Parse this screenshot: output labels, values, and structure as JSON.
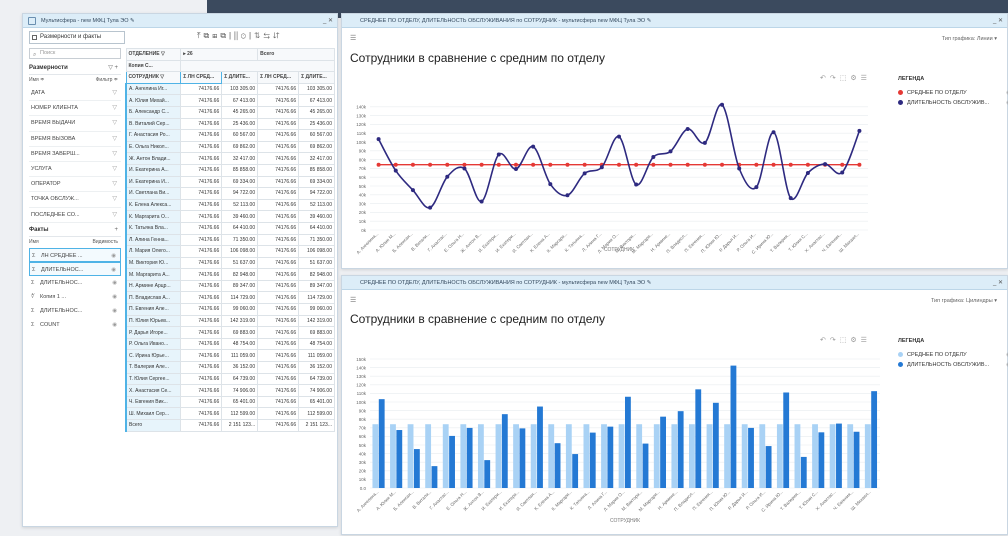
{
  "colors": {
    "accent": "#4fb3e6",
    "line_series": "#2e2a80",
    "avg_series": "#e53935",
    "bar_dark": "#2479d4",
    "bar_light": "#a9d2f5"
  },
  "left_panel": {
    "title": "Мультисфера - new МФЦ Тула ЭО ✎",
    "dropdown": "Размерности и факты",
    "search_placeholder": "Поиск",
    "dims_header": "Размерности",
    "dims_sub_left": "Имя ≑",
    "dims_sub_right": "Фильтр ≑",
    "dims": [
      "ДАТА",
      "НОМЕР КЛИЕНТА",
      "ВРЕМЯ ВЫДАЧИ",
      "ВРЕМЯ ВЫЗОВА",
      "ВРЕМЯ ЗАВЕРШ...",
      "УСЛУГА",
      "ОПЕРАТОР",
      "ТОЧКА ОБСЛУЖ...",
      "ПОСЛЕДНЕЕ СО..."
    ],
    "facts_header": "Факты",
    "facts_sub_left": "Имя",
    "facts_sub_right": "Видимость",
    "facts": [
      {
        "prefix": "Σ",
        "label": "ЛН СРЕДНЕЕ ...",
        "sel": true
      },
      {
        "prefix": "Σ",
        "label": "ДЛИТЕЛЬНОС...",
        "sel": true
      },
      {
        "prefix": "Σ",
        "label": "ДЛИТЕЛЬНОС...",
        "sel": false
      },
      {
        "prefix": "∜",
        "label": "Копия 1 ...",
        "sel": false
      },
      {
        "prefix": "Σ",
        "label": "ДЛИТЕЛЬНОС...",
        "sel": false
      },
      {
        "prefix": "Σ",
        "label": "COUNT",
        "sel": false
      }
    ]
  },
  "grid": {
    "h1_left": "ОТДЕЛЕНИЕ",
    "h1_count": "▸ 26",
    "h1_total": "Всего",
    "h2_left": "Копия С...",
    "h3_name": "СОТРУДНИК",
    "h3_cols": [
      "Σ ЛН СРЕД...",
      "Σ ДЛИТЕ...",
      "Σ ЛН СРЕД...",
      "Σ ДЛИТЕ..."
    ],
    "rows": [
      [
        "А. Ангелина Иг...",
        "74176.66",
        "103 305.00",
        "74176.66",
        "103 305.00"
      ],
      [
        "А. Юлия Михай...",
        "74176.66",
        "67 413.00",
        "74176.66",
        "67 413.00"
      ],
      [
        "Б. Александр С...",
        "74176.66",
        "45 265.00",
        "74176.66",
        "45 265.00"
      ],
      [
        "В. Виталий Сер...",
        "74176.66",
        "25 436.00",
        "74176.66",
        "25 436.00"
      ],
      [
        "Г. Анастасия Ро...",
        "74176.66",
        "60 567.00",
        "74176.66",
        "60 567.00"
      ],
      [
        "Е. Ольга Никол...",
        "74176.66",
        "69 862.00",
        "74176.66",
        "69 862.00"
      ],
      [
        "Ж. Антон Влади...",
        "74176.66",
        "32 417.00",
        "74176.66",
        "32 417.00"
      ],
      [
        "И. Екатерина А...",
        "74176.66",
        "85 858.00",
        "74176.66",
        "85 858.00"
      ],
      [
        "И. Екатерина И...",
        "74176.66",
        "69 334.00",
        "74176.66",
        "69 334.00"
      ],
      [
        "И. Светлана Ви...",
        "74176.66",
        "94 722.00",
        "74176.66",
        "94 722.00"
      ],
      [
        "К. Елена Алекса...",
        "74176.66",
        "52 113.00",
        "74176.66",
        "52 113.00"
      ],
      [
        "К. Маргарита О...",
        "74176.66",
        "39 460.00",
        "74176.66",
        "39 460.00"
      ],
      [
        "К. Татьяна Вла...",
        "74176.66",
        "64 410.00",
        "74176.66",
        "64 410.00"
      ],
      [
        "Л. Алина Генна...",
        "74176.66",
        "71 350.00",
        "74176.66",
        "71 350.00"
      ],
      [
        "Л. Мария Олего...",
        "74176.66",
        "106 098.00",
        "74176.66",
        "106 098.00"
      ],
      [
        "М. Виктория Ю...",
        "74176.66",
        "51 637.00",
        "74176.66",
        "51 637.00"
      ],
      [
        "М. Маргарита А...",
        "74176.66",
        "82 948.00",
        "74176.66",
        "82 948.00"
      ],
      [
        "Н. Армине Арцр...",
        "74176.66",
        "89 347.00",
        "74176.66",
        "89 347.00"
      ],
      [
        "П. Владислав А...",
        "74176.66",
        "114 729.00",
        "74176.66",
        "114 729.00"
      ],
      [
        "П. Евгения Але...",
        "74176.66",
        "99 060.00",
        "74176.66",
        "99 060.00"
      ],
      [
        "П. Юлия Юрьев...",
        "74176.66",
        "142 319.00",
        "74176.66",
        "142 319.00"
      ],
      [
        "Р. Дарья Игоре...",
        "74176.66",
        "69 883.00",
        "74176.66",
        "69 883.00"
      ],
      [
        "Р. Ольга Ивано...",
        "74176.66",
        "48 754.00",
        "74176.66",
        "48 754.00"
      ],
      [
        "С. Ирина Юрье...",
        "74176.66",
        "111 059.00",
        "74176.66",
        "111 059.00"
      ],
      [
        "Т. Валерия Але...",
        "74176.66",
        "36 152.00",
        "74176.66",
        "36 152.00"
      ],
      [
        "Т. Юлия Сергее...",
        "74176.66",
        "64 739.00",
        "74176.66",
        "64 739.00"
      ],
      [
        "Х. Анастасия Се...",
        "74176.66",
        "74 906.00",
        "74176.66",
        "74 906.00"
      ],
      [
        "Ч. Евгения Вик...",
        "74176.66",
        "65 401.00",
        "74176.66",
        "65 401.00"
      ],
      [
        "Ш. Михаил Сер...",
        "74176.66",
        "112 599.00",
        "74176.66",
        "112 599.00"
      ]
    ],
    "total": [
      "Всего",
      "74176.66",
      "2 151 123...",
      "74176.66",
      "2 151 123..."
    ]
  },
  "chart_data": [
    {
      "type": "line",
      "panel_title": "СРЕДНЕЕ ПО ОТДЕЛУ, ДЛИТЕЛЬНОСТЬ ОБСЛУЖИВАНИЯ по СОТРУДНИК - мультисфера new МФЦ Тула ЭО ✎",
      "title": "Сотрудники в сравнение с средним по отделу",
      "chart_type_label": "Тип графика:",
      "chart_type_value": "Линии",
      "legend_title": "ЛЕГЕНДА",
      "xlabel": "СОТРУДНИК",
      "ylim": [
        0,
        150000
      ],
      "y_ticks": [
        "0k",
        "10k",
        "20k",
        "30k",
        "40k",
        "50k",
        "60k",
        "70k",
        "80k",
        "90k",
        "100k",
        "110k",
        "120k",
        "130k",
        "140k"
      ],
      "categories": [
        "А. Ангелина...",
        "А. Юлия М...",
        "Б. Алексан...",
        "В. Витали...",
        "Г. Анастас...",
        "Е. Ольга Н...",
        "Ж. Антон В...",
        "И. Екатери...",
        "И. Екатери...",
        "И. Светлан...",
        "К. Елена А...",
        "К. Маргари...",
        "К. Татьяна...",
        "Л. Алина Г...",
        "Л. Мария О...",
        "М. Виктори...",
        "М. Маргари...",
        "Н. Армине...",
        "П. Владисл...",
        "П. Евгения...",
        "П. Юлия Ю...",
        "Р. Дарья И...",
        "Р. Ольга И...",
        "С. Ирина Ю...",
        "Т. Валерия...",
        "Т. Юлия С...",
        "Х. Анастас...",
        "Ч. Евгения...",
        "Ш. Михаил..."
      ],
      "series": [
        {
          "name": "СРЕДНЕЕ ПО ОТДЕЛУ",
          "color": "#e53935",
          "values": [
            74176.66,
            74176.66,
            74176.66,
            74176.66,
            74176.66,
            74176.66,
            74176.66,
            74176.66,
            74176.66,
            74176.66,
            74176.66,
            74176.66,
            74176.66,
            74176.66,
            74176.66,
            74176.66,
            74176.66,
            74176.66,
            74176.66,
            74176.66,
            74176.66,
            74176.66,
            74176.66,
            74176.66,
            74176.66,
            74176.66,
            74176.66,
            74176.66,
            74176.66
          ]
        },
        {
          "name": "ДЛИТЕЛЬНОСТЬ ОБСЛУЖИВ...",
          "color": "#2e2a80",
          "values": [
            103305,
            67413,
            45265,
            25436,
            60567,
            69862,
            32417,
            85858,
            69334,
            94722,
            52113,
            39460,
            64410,
            71350,
            106098,
            51637,
            82948,
            89347,
            114729,
            99060,
            142319,
            69883,
            48754,
            111059,
            36152,
            64739,
            74906,
            65401,
            112599
          ]
        }
      ]
    },
    {
      "type": "bar",
      "panel_title": "СРЕДНЕЕ ПО ОТДЕЛУ, ДЛИТЕЛЬНОСТЬ ОБСЛУЖИВАНИЯ по СОТРУДНИК - мультисфера new МФЦ Тула ЭО ✎",
      "title": "Сотрудники в сравнение с средним по отделу",
      "chart_type_label": "Тип графика:",
      "chart_type_value": "Цилиндры",
      "legend_title": "ЛЕГЕНДА",
      "xlabel": "СОТРУДНИК",
      "ylim": [
        0,
        150000
      ],
      "y_ticks": [
        "0.0",
        "10k",
        "20k",
        "30k",
        "40k",
        "50k",
        "60k",
        "70k",
        "80k",
        "90k",
        "100k",
        "110k",
        "120k",
        "130k",
        "140k",
        "150k"
      ],
      "categories": [
        "А. Ангелина...",
        "А. Юлия М...",
        "Б. Алексан...",
        "В. Витали...",
        "Г. Анастас...",
        "Е. Ольга Н...",
        "Ж. Антон В...",
        "И. Екатери...",
        "И. Екатери...",
        "И. Светлан...",
        "К. Елена А...",
        "К. Маргари...",
        "К. Татьяна...",
        "Л. Алина Г...",
        "Л. Мария О...",
        "М. Виктори...",
        "М. Маргари...",
        "Н. Армине...",
        "П. Владисл...",
        "П. Евгения...",
        "П. Юлия Ю...",
        "Р. Дарья И...",
        "Р. Ольга И...",
        "С. Ирина Ю...",
        "Т. Валерия...",
        "Т. Юлия С...",
        "Х. Анастас...",
        "Ч. Евгения...",
        "Ш. Михаил..."
      ],
      "series": [
        {
          "name": "СРЕДНЕЕ ПО ОТДЕЛУ",
          "color": "#a9d2f5",
          "values": [
            74176.66,
            74176.66,
            74176.66,
            74176.66,
            74176.66,
            74176.66,
            74176.66,
            74176.66,
            74176.66,
            74176.66,
            74176.66,
            74176.66,
            74176.66,
            74176.66,
            74176.66,
            74176.66,
            74176.66,
            74176.66,
            74176.66,
            74176.66,
            74176.66,
            74176.66,
            74176.66,
            74176.66,
            74176.66,
            74176.66,
            74176.66,
            74176.66,
            74176.66
          ]
        },
        {
          "name": "ДЛИТЕЛЬНОСТЬ ОБСЛУЖИВ...",
          "color": "#2479d4",
          "values": [
            103305,
            67413,
            45265,
            25436,
            60567,
            69862,
            32417,
            85858,
            69334,
            94722,
            52113,
            39460,
            64410,
            71350,
            106098,
            51637,
            82948,
            89347,
            114729,
            99060,
            142319,
            69883,
            48754,
            111059,
            36152,
            64739,
            74906,
            65401,
            112599
          ]
        }
      ]
    }
  ]
}
